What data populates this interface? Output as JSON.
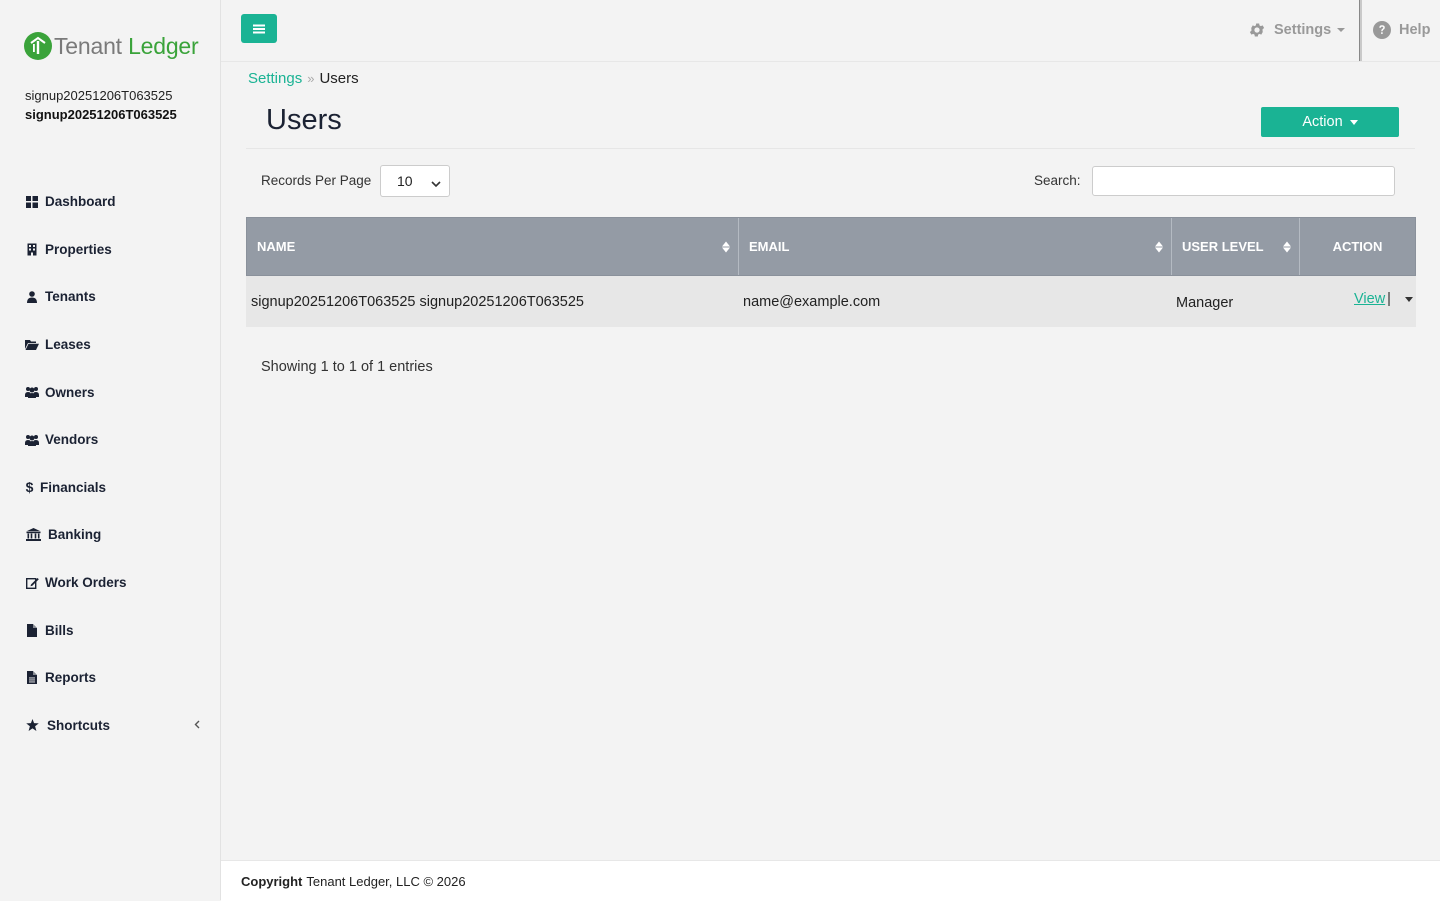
{
  "brand": {
    "name_part1": "Tenant",
    "name_part2": "Ledger",
    "accent_color": "#1ab394",
    "logo_color": "#3aa33a"
  },
  "user": {
    "line1": "signup20251206T063525",
    "line2": "signup20251206T063525"
  },
  "sidebar": {
    "items": [
      {
        "label": "Dashboard",
        "icon": "dashboard-icon"
      },
      {
        "label": "Properties",
        "icon": "building-icon"
      },
      {
        "label": "Tenants",
        "icon": "user-icon"
      },
      {
        "label": "Leases",
        "icon": "folder-open-icon"
      },
      {
        "label": "Owners",
        "icon": "users-icon"
      },
      {
        "label": "Vendors",
        "icon": "users-icon"
      },
      {
        "label": "Financials",
        "icon": "dollar-icon"
      },
      {
        "label": "Banking",
        "icon": "bank-icon"
      },
      {
        "label": "Work Orders",
        "icon": "edit-icon"
      },
      {
        "label": "Bills",
        "icon": "file-icon"
      },
      {
        "label": "Reports",
        "icon": "file-text-icon"
      },
      {
        "label": "Shortcuts",
        "icon": "star-icon"
      }
    ]
  },
  "header": {
    "settings_label": "Settings",
    "help_label": "Help"
  },
  "breadcrumb": {
    "parent": "Settings",
    "current": "Users"
  },
  "page": {
    "title": "Users",
    "action_label": "Action"
  },
  "controls": {
    "records_per_page_label": "Records Per Page",
    "records_per_page_value": "10",
    "search_label": "Search:",
    "search_value": ""
  },
  "table": {
    "columns": [
      "NAME",
      "EMAIL",
      "USER LEVEL",
      "ACTION"
    ],
    "rows": [
      {
        "name": "signup20251206T063525 signup20251206T063525",
        "email": "name@example.com",
        "user_level": "Manager",
        "action_label": "View",
        "separator": "|"
      }
    ]
  },
  "summary": {
    "showing": "Showing 1 to 1 of 1 entries"
  },
  "footer": {
    "copyright_label": "Copyright",
    "copyright_text": "Tenant Ledger, LLC © 2026"
  }
}
